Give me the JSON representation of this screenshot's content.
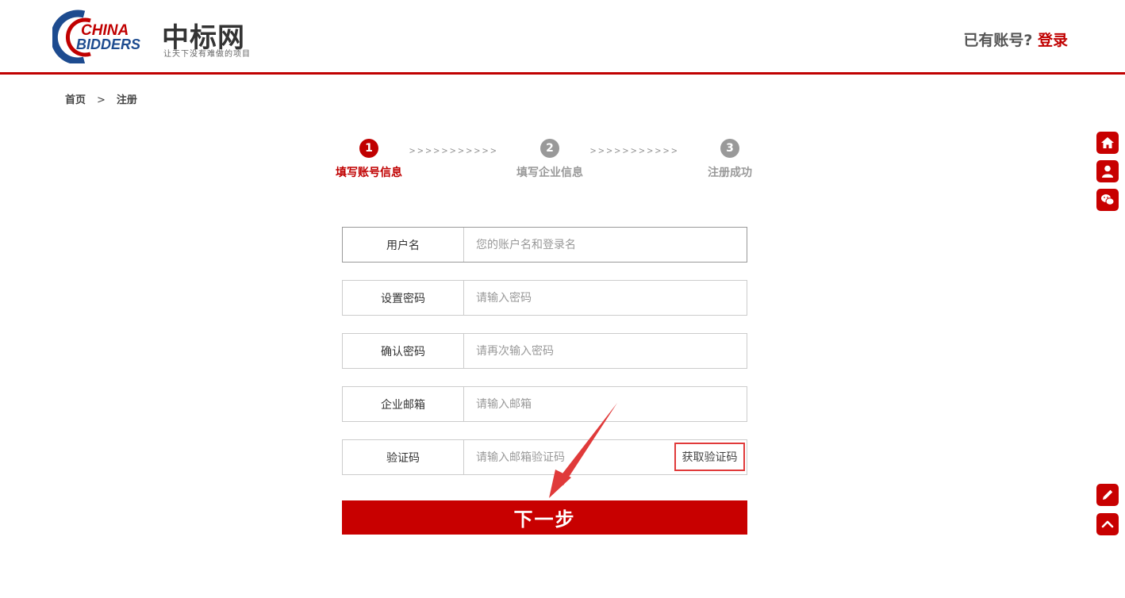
{
  "header": {
    "logo_line1": "CHINA",
    "logo_line2": "BIDDERS",
    "logo_cn": "中标网",
    "slogan": "让天下没有难做的项目",
    "have_account": "已有账号?",
    "login_link": "登录"
  },
  "breadcrumb": {
    "home": "首页",
    "separator": ">",
    "current": "注册"
  },
  "steps": [
    {
      "num": "1",
      "label": "填写账号信息",
      "state": "active"
    },
    {
      "num": "2",
      "label": "填写企业信息",
      "state": "inactive"
    },
    {
      "num": "3",
      "label": "注册成功",
      "state": "inactive"
    }
  ],
  "step_arrows": ">>>>>>>>>>>",
  "form": {
    "username": {
      "label": "用户名",
      "placeholder": "您的账户名和登录名"
    },
    "password": {
      "label": "设置密码",
      "placeholder": "请输入密码"
    },
    "confirm": {
      "label": "确认密码",
      "placeholder": "请再次输入密码"
    },
    "email": {
      "label": "企业邮箱",
      "placeholder": "请输入邮箱"
    },
    "code": {
      "label": "验证码",
      "placeholder": "请输入邮箱验证码",
      "button": "获取验证码"
    },
    "submit": "下一步"
  },
  "side_toolbar": [
    "home-icon",
    "user-icon",
    "wechat-icon",
    "edit-icon",
    "chevron-up-icon"
  ],
  "colors": {
    "brand_red": "#c00000",
    "button_red": "#c80000",
    "annotation_red": "#e03a3a",
    "brand_blue": "#1d4b8f"
  }
}
